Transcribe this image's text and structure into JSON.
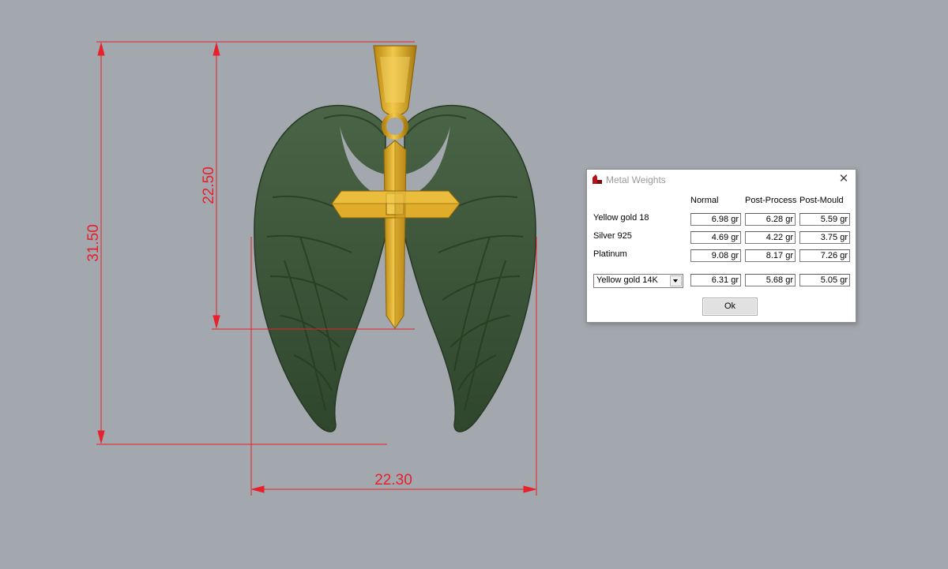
{
  "dimensions": {
    "total_height": "31.50",
    "cross_height": "22.50",
    "width": "22.30"
  },
  "dialog": {
    "title": "Metal Weights",
    "columns": [
      "Normal",
      "Post-Process",
      "Post-Mould"
    ],
    "rows": [
      {
        "label": "Yellow gold 18",
        "values": [
          "6.98 gr",
          "6.28 gr",
          "5.59 gr"
        ]
      },
      {
        "label": "Silver 925",
        "values": [
          "4.69 gr",
          "4.22 gr",
          "3.75 gr"
        ]
      },
      {
        "label": "Platinum",
        "values": [
          "9.08 gr",
          "8.17 gr",
          "7.26 gr"
        ]
      }
    ],
    "custom": {
      "selected_alloy": "Yellow gold 14K",
      "values": [
        "6.31 gr",
        "5.68 gr",
        "5.05 gr"
      ]
    },
    "ok_label": "Ok"
  },
  "colors": {
    "background": "#a3a7ae",
    "dimension": "#e8202a",
    "wing": "#3d5538",
    "gold": "#e3b12a"
  },
  "icons": [
    "app-icon",
    "close-icon",
    "dropdown-arrow-icon"
  ]
}
